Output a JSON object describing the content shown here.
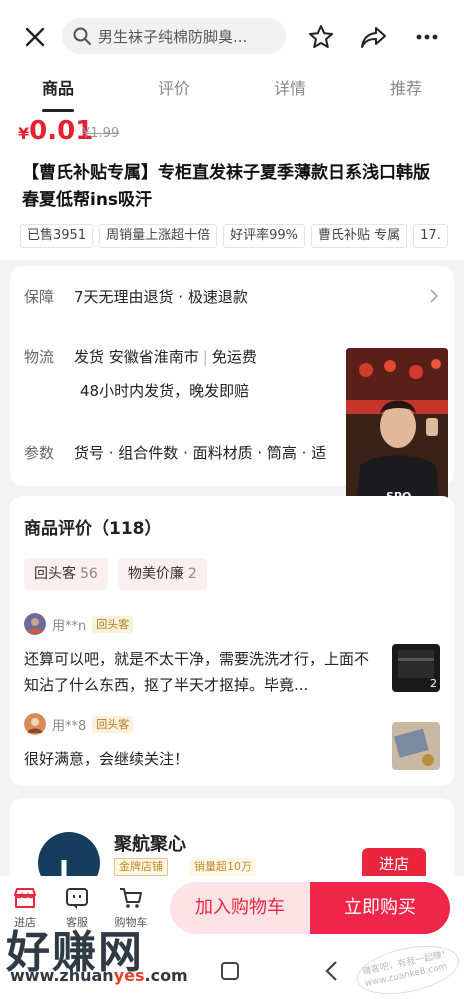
{
  "topbar": {
    "search_placeholder": "男生袜子纯棉防脚臭...",
    "icons": [
      "close-icon",
      "search-icon",
      "star-icon",
      "share-icon",
      "more-icon"
    ]
  },
  "tabs": [
    {
      "label": "商品",
      "active": true
    },
    {
      "label": "评价",
      "active": false
    },
    {
      "label": "详情",
      "active": false
    },
    {
      "label": "推荐",
      "active": false
    }
  ],
  "product": {
    "currency": "¥",
    "price": "0.01",
    "original_price": "¥1.99",
    "title": "【曹氏补贴专属】专柜直发袜子夏季薄款日系浅口韩版春夏低帮ins吸汗",
    "tags": [
      "已售3951",
      "周销量上涨超十倍",
      "好评率99%",
      "曹氏补贴 专属",
      "17."
    ]
  },
  "info": {
    "guarantee_label": "保障",
    "guarantee_text": "7天无理由退货 · 极速退款",
    "logistics_label": "物流",
    "logistics_ship": "发货 安徽省淮南市",
    "logistics_fee": "免运费",
    "logistics_time": "48小时内发货，晚发即赔",
    "params_label": "参数",
    "params_text": "货号 · 组合件数 · 面料材质 · 筒高 · 适"
  },
  "reviews": {
    "title": "商品评价（118）",
    "chips": [
      {
        "label": "回头客",
        "count": "56"
      },
      {
        "label": "物美价廉",
        "count": "2"
      }
    ],
    "items": [
      {
        "user": "用**n",
        "badge": "回头客",
        "text": "还算可以吧，就是不太干净，需要洗洗才行，上面不知沾了什么东西，抠了半天才抠掉。毕竟...",
        "thumb_count": "2"
      },
      {
        "user": "用**8",
        "badge": "回头客",
        "text": "很好满意，会继续关注！",
        "thumb_count": ""
      }
    ]
  },
  "store": {
    "name": "聚航聚心",
    "badge1": "金牌店铺",
    "badge2": "销量超10万",
    "enter_label": "进店"
  },
  "bottom": {
    "store_label": "进店",
    "service_label": "客服",
    "cart_label": "购物车",
    "add_cart": "加入购物车",
    "buy_now": "立即购买"
  },
  "watermark": {
    "brand": "好赚网",
    "url_a": "www.zhuan",
    "url_b": "yes",
    "url_c": ".com",
    "stamp": "赚客吧，有我一起赚！ www.zuanke8.com"
  },
  "colors": {
    "accent": "#e8263f",
    "price": "#e8202e"
  }
}
